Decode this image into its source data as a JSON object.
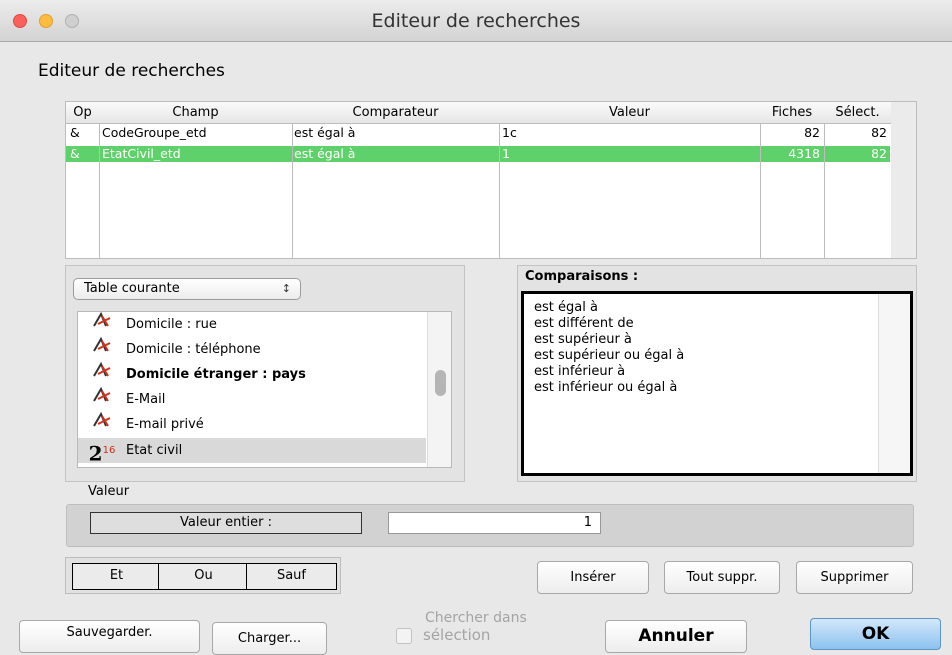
{
  "window": {
    "title": "Editeur de recherches",
    "traffic_lights": {
      "close": "#fc605c",
      "minimize": "#fdbc40",
      "zoom": "#cfcfcf"
    }
  },
  "dialog": {
    "heading": "Editeur de recherches"
  },
  "criteria_table": {
    "columns": [
      "Op",
      "Champ",
      "Comparateur",
      "Valeur",
      "Fiches",
      "Sélect."
    ],
    "rows": [
      {
        "op": "&",
        "champ": "CodeGroupe_etd",
        "comparateur": "est égal à",
        "valeur": "1c",
        "fiches": "82",
        "select": "82",
        "selected": false
      },
      {
        "op": "&",
        "champ": "EtatCivil_etd",
        "comparateur": "est égal à",
        "valeur": "1",
        "fiches": "4318",
        "select": "82",
        "selected": true
      }
    ],
    "selection_color": "#5fd16a"
  },
  "field_panel": {
    "table_select": "Table courante",
    "items": [
      {
        "label": "Domicile : rue",
        "icon": "text-field-icon",
        "bold": false
      },
      {
        "label": "Domicile : téléphone",
        "icon": "text-field-icon",
        "bold": false
      },
      {
        "label": "Domicile étranger : pays",
        "icon": "text-field-icon",
        "bold": true
      },
      {
        "label": "E-Mail",
        "icon": "text-field-icon",
        "bold": false
      },
      {
        "label": "E-mail privé",
        "icon": "text-field-icon",
        "bold": false
      },
      {
        "label": "Etat civil",
        "icon": "integer-field-icon",
        "icon_text": "2",
        "icon_sup": "16",
        "bold": false,
        "selected": true
      }
    ]
  },
  "comparisons": {
    "label": "Comparaisons :",
    "items": [
      "est égal à",
      "est différent de",
      "est supérieur à",
      "est supérieur ou égal à",
      "est inférieur à",
      "est inférieur ou égal à"
    ]
  },
  "value": {
    "label": "Valeur",
    "type_label": "Valeur entier :",
    "input_value": "1"
  },
  "operators": {
    "et": "Et",
    "ou": "Ou",
    "sauf": "Sauf"
  },
  "actions": {
    "inserer": "Insérer",
    "tout_suppr": "Tout suppr.",
    "supprimer": "Supprimer"
  },
  "footer": {
    "sauvegarder": "Sauvegarder.",
    "charger": "Charger...",
    "chercher_line1": "Chercher dans",
    "chercher_line2": "sélection",
    "annuler": "Annuler",
    "ok": "OK"
  }
}
